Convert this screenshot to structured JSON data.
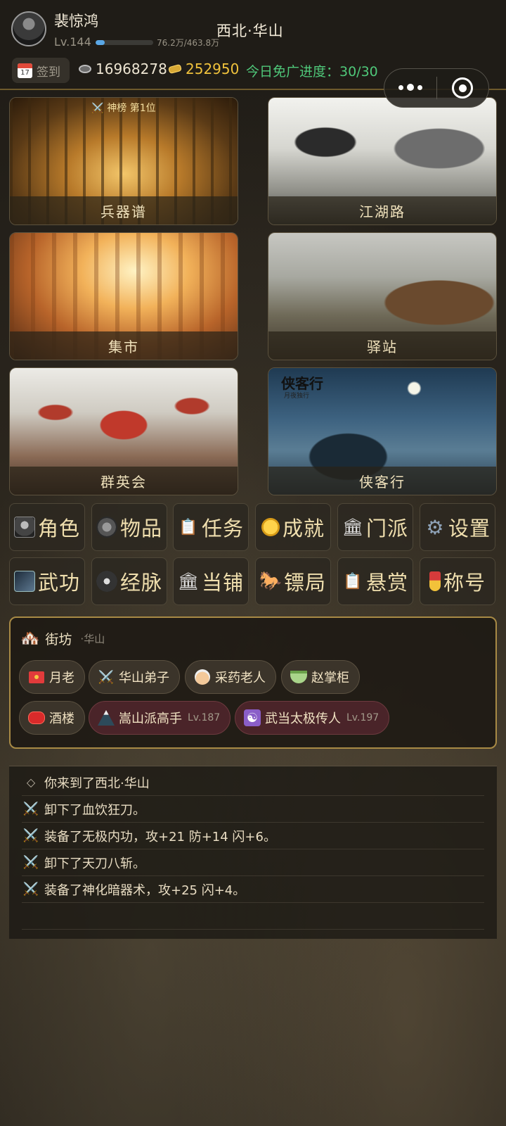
{
  "header": {
    "player_name": "裴惊鸿",
    "level": "Lv.144",
    "exp_text": "76.2万/463.8万",
    "exp_fraction": 0.164,
    "location": "西北·华山",
    "signin_label": "签到",
    "calendar_day": "17",
    "silver": "16968278",
    "gold": "252950",
    "ad_progress": "今日免广进度：30/30"
  },
  "scenes": [
    {
      "label": "兵器谱",
      "badge": "⚔️ 神榜 第1位",
      "art": "armory"
    },
    {
      "label": "江湖路",
      "art": "road"
    },
    {
      "label": "集市",
      "art": "market"
    },
    {
      "label": "驿站",
      "art": "station"
    },
    {
      "label": "群英会",
      "art": "heroes"
    },
    {
      "label": "侠客行",
      "art": "wanderer",
      "brush_title": "侠客行",
      "brush_sub": "月夜独行"
    }
  ],
  "menu": [
    {
      "label": "角色",
      "icon": "portrait-icon"
    },
    {
      "label": "物品",
      "icon": "item-icon"
    },
    {
      "label": "任务",
      "icon": "clipboard-icon"
    },
    {
      "label": "成就",
      "icon": "medal-icon"
    },
    {
      "label": "门派",
      "icon": "temple-icon"
    },
    {
      "label": "设置",
      "icon": "gear-icon"
    },
    {
      "label": "武功",
      "icon": "martial-icon"
    },
    {
      "label": "经脉",
      "icon": "meridian-icon"
    },
    {
      "label": "当铺",
      "icon": "bank-icon"
    },
    {
      "label": "镖局",
      "icon": "horse-icon"
    },
    {
      "label": "悬赏",
      "icon": "clipboard-icon"
    },
    {
      "label": "称号",
      "icon": "ribbon-medal-icon"
    }
  ],
  "street": {
    "title": "街坊",
    "location": "·华山",
    "npcs": [
      {
        "name": "月老",
        "icon": "red-envelope-icon"
      },
      {
        "name": "华山弟子",
        "icon": "crossed-swords-icon"
      },
      {
        "name": "采药老人",
        "icon": "old-man-icon"
      },
      {
        "name": "赵掌柜",
        "icon": "bowl-icon"
      },
      {
        "name": "酒楼",
        "icon": "lantern-icon"
      },
      {
        "name": "嵩山派高手",
        "level": "Lv.187",
        "icon": "mountain-icon",
        "hostile": true
      },
      {
        "name": "武当太极传人",
        "level": "Lv.197",
        "icon": "yin-yang-icon",
        "hostile": true
      }
    ]
  },
  "log": [
    {
      "icon": "diamond-icon",
      "text": "你来到了西北·华山"
    },
    {
      "icon": "crossed-swords-icon",
      "text": "卸下了血饮狂刀。"
    },
    {
      "icon": "crossed-swords-icon",
      "text": "装备了无极内功，攻+21 防+14 闪+6。"
    },
    {
      "icon": "crossed-swords-icon",
      "text": "卸下了天刀八斩。"
    },
    {
      "icon": "crossed-swords-icon",
      "text": "装备了神化暗器术，攻+25 闪+4。"
    }
  ],
  "symbols": {
    "swords": "⚔️",
    "house": "🏘️",
    "diamond": "◇",
    "scroll": "📋",
    "temple": "🏛",
    "gear": "⚙",
    "bank": "🏛",
    "horse": "🐎",
    "yinyang": "☯"
  }
}
